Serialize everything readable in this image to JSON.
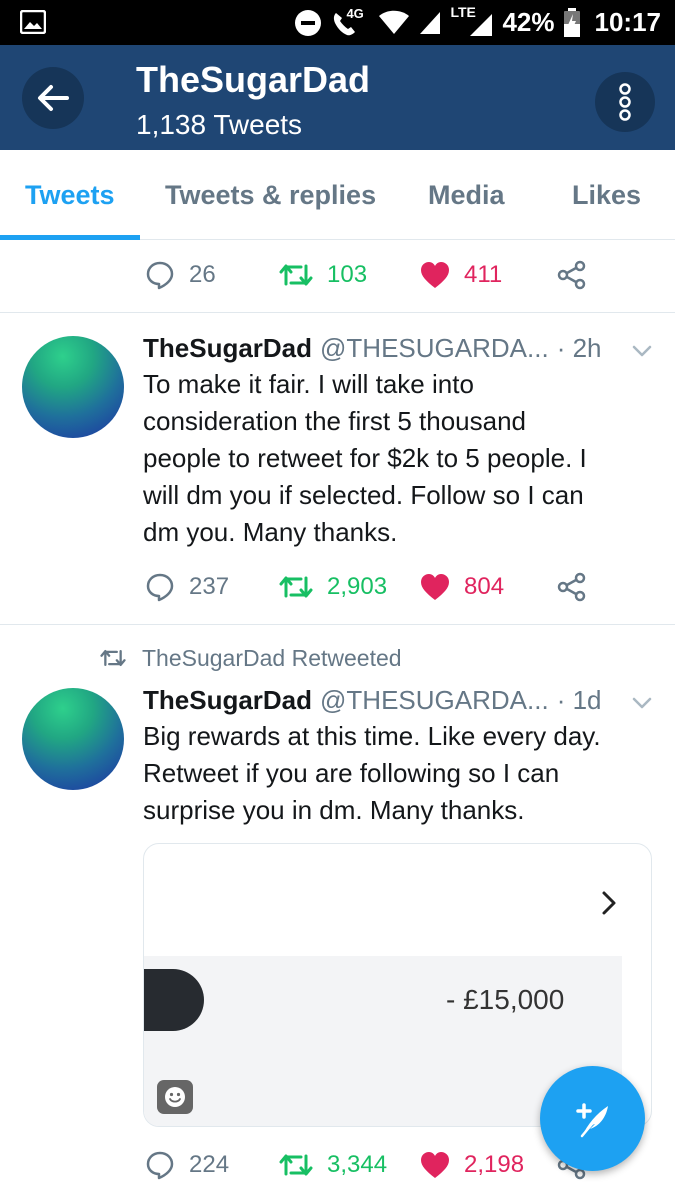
{
  "status_bar": {
    "network_4g": "4G",
    "network_lte": "LTE",
    "battery": "42%",
    "time": "10:17"
  },
  "header": {
    "title": "TheSugarDad",
    "subtitle": "1,138 Tweets"
  },
  "tabs": [
    {
      "label": "Tweets",
      "active": true
    },
    {
      "label": "Tweets & replies",
      "active": false
    },
    {
      "label": "Media",
      "active": false
    },
    {
      "label": "Likes",
      "active": false
    }
  ],
  "tweets": [
    {
      "stats": {
        "replies": "26",
        "retweets": "103",
        "likes": "411"
      }
    },
    {
      "name": "TheSugarDad",
      "handle": "@THESUGARDA...",
      "time": "· 2h",
      "text_lines": [
        "To make it fair. I will take into",
        "consideration the first 5 thousand",
        "people to retweet for $2k to 5 people. I",
        "will dm you if selected. Follow so I can",
        "dm you. Many thanks."
      ],
      "stats": {
        "replies": "237",
        "retweets": "2,903",
        "likes": "804"
      }
    },
    {
      "retweeted_label": "TheSugarDad Retweeted",
      "name": "TheSugarDad",
      "handle": "@THESUGARDA...",
      "time": "· 1d",
      "text_lines": [
        "Big rewards at this time. Like every day.",
        "Retweet if you are following so I can",
        "surprise you in dm. Many thanks."
      ],
      "media": {
        "amount": "- £15,000"
      },
      "stats": {
        "replies": "224",
        "retweets": "3,344",
        "likes": "2,198"
      }
    }
  ],
  "colors": {
    "header_bg": "#1f4674",
    "accent": "#1da1f2",
    "retweet": "#17bf63",
    "like": "#e0245e",
    "secondary_text": "#657786"
  },
  "icons": [
    "gallery-icon",
    "dnd-icon",
    "wifi-call-icon",
    "wifi-icon",
    "signal-icon",
    "battery-icon",
    "back-arrow-icon",
    "more-vertical-icon",
    "reply-icon",
    "retweet-icon",
    "heart-icon",
    "share-icon",
    "chevron-down-icon",
    "chevron-right-icon",
    "smiley-icon",
    "compose-icon"
  ]
}
